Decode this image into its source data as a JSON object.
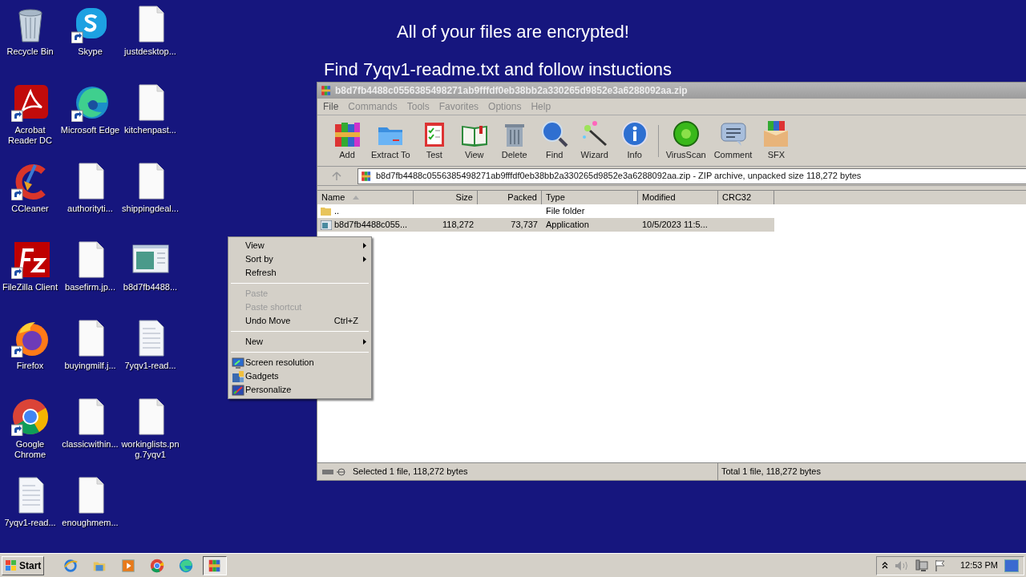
{
  "banner": {
    "headline": "All of your files are encrypted!",
    "instruction": "Find 7yqv1-readme.txt and follow instuctions"
  },
  "desktop": {
    "icons": [
      {
        "label": "Recycle Bin",
        "kind": "recycle",
        "shortcut": false
      },
      {
        "label": "Acrobat Reader DC",
        "kind": "acrobat",
        "shortcut": true
      },
      {
        "label": "CCleaner",
        "kind": "ccleaner",
        "shortcut": true
      },
      {
        "label": "FileZilla Client",
        "kind": "filezilla",
        "shortcut": true
      },
      {
        "label": "Firefox",
        "kind": "firefox",
        "shortcut": true
      },
      {
        "label": "Google Chrome",
        "kind": "chrome",
        "shortcut": true
      },
      {
        "label": "7yqv1-read...",
        "kind": "textfile",
        "shortcut": false
      },
      {
        "label": "Skype",
        "kind": "skype",
        "shortcut": true
      },
      {
        "label": "Microsoft Edge",
        "kind": "edge",
        "shortcut": true
      },
      {
        "label": "authorityti...",
        "kind": "file",
        "shortcut": false
      },
      {
        "label": "basefirm.jp...",
        "kind": "file",
        "shortcut": false
      },
      {
        "label": "buyingmilf.j...",
        "kind": "file",
        "shortcut": false
      },
      {
        "label": "classicwithin...",
        "kind": "file",
        "shortcut": false
      },
      {
        "label": "enoughmem...",
        "kind": "file",
        "shortcut": false
      },
      {
        "label": "justdesktop...",
        "kind": "file",
        "shortcut": false
      },
      {
        "label": "kitchenpast...",
        "kind": "file",
        "shortcut": false
      },
      {
        "label": "shippingdeal...",
        "kind": "file",
        "shortcut": false
      },
      {
        "label": "b8d7fb4488...",
        "kind": "exe",
        "shortcut": false
      },
      {
        "label": "7yqv1-read...",
        "kind": "textfile",
        "shortcut": false
      },
      {
        "label": "workinglists.png.7yqv1",
        "kind": "file",
        "shortcut": false
      }
    ]
  },
  "winrar": {
    "title": "b8d7fb4488c0556385498271ab9fffdf0eb38bb2a330265d9852e3a6288092aa.zip",
    "menu": [
      "File",
      "Commands",
      "Tools",
      "Favorites",
      "Options",
      "Help"
    ],
    "toolbar": [
      {
        "label": "Add",
        "kind": "add"
      },
      {
        "label": "Extract To",
        "kind": "extract"
      },
      {
        "label": "Test",
        "kind": "test"
      },
      {
        "label": "View",
        "kind": "view"
      },
      {
        "label": "Delete",
        "kind": "delete"
      },
      {
        "label": "Find",
        "kind": "find"
      },
      {
        "label": "Wizard",
        "kind": "wizard"
      },
      {
        "label": "Info",
        "kind": "info"
      },
      {
        "label": "VirusScan",
        "kind": "virusscan"
      },
      {
        "label": "Comment",
        "kind": "comment"
      },
      {
        "label": "SFX",
        "kind": "sfx"
      }
    ],
    "address": "b8d7fb4488c0556385498271ab9fffdf0eb38bb2a330265d9852e3a6288092aa.zip - ZIP archive, unpacked size 118,272 bytes",
    "columns": [
      {
        "label": "Name",
        "sorted": true
      },
      {
        "label": "Size",
        "sorted": false
      },
      {
        "label": "Packed",
        "sorted": false
      },
      {
        "label": "Type",
        "sorted": false
      },
      {
        "label": "Modified",
        "sorted": false
      },
      {
        "label": "CRC32",
        "sorted": false
      }
    ],
    "rows": [
      {
        "kind": "folder",
        "name": "..",
        "size": "",
        "packed": "",
        "type": "File folder",
        "modified": "",
        "selected": false
      },
      {
        "kind": "app",
        "name": "b8d7fb4488c055...",
        "size": "118,272",
        "packed": "73,737",
        "type": "Application",
        "modified": "10/5/2023 11:5...",
        "selected": true
      }
    ],
    "status_left": "Selected 1 file, 118,272 bytes",
    "status_right": "Total 1 file, 118,272 bytes"
  },
  "context_menu": {
    "items": [
      {
        "kind": "item",
        "label": "View",
        "submenu": true,
        "disabled": false
      },
      {
        "kind": "item",
        "label": "Sort by",
        "submenu": true,
        "disabled": false
      },
      {
        "kind": "item",
        "label": "Refresh",
        "submenu": false,
        "disabled": false
      },
      {
        "kind": "separator"
      },
      {
        "kind": "item",
        "label": "Paste",
        "submenu": false,
        "disabled": true
      },
      {
        "kind": "item",
        "label": "Paste shortcut",
        "submenu": false,
        "disabled": true
      },
      {
        "kind": "item",
        "label": "Undo Move",
        "submenu": false,
        "disabled": false,
        "shortcut": "Ctrl+Z"
      },
      {
        "kind": "separator"
      },
      {
        "kind": "item",
        "label": "New",
        "submenu": true,
        "disabled": false
      },
      {
        "kind": "separator"
      },
      {
        "kind": "display",
        "label": "Screen resolution",
        "submenu": false,
        "disabled": false
      },
      {
        "kind": "gadgets",
        "label": "Gadgets",
        "submenu": false,
        "disabled": false
      },
      {
        "kind": "personalize",
        "label": "Personalize",
        "submenu": false,
        "disabled": false
      }
    ]
  },
  "taskbar": {
    "start": "Start",
    "apps": [
      {
        "kind": "ie",
        "active": false
      },
      {
        "kind": "explorer",
        "active": false
      },
      {
        "kind": "media",
        "active": false
      },
      {
        "kind": "chrome",
        "active": false
      },
      {
        "kind": "edge",
        "active": false
      },
      {
        "kind": "winrar",
        "active": true
      }
    ],
    "clock": "12:53 PM"
  }
}
